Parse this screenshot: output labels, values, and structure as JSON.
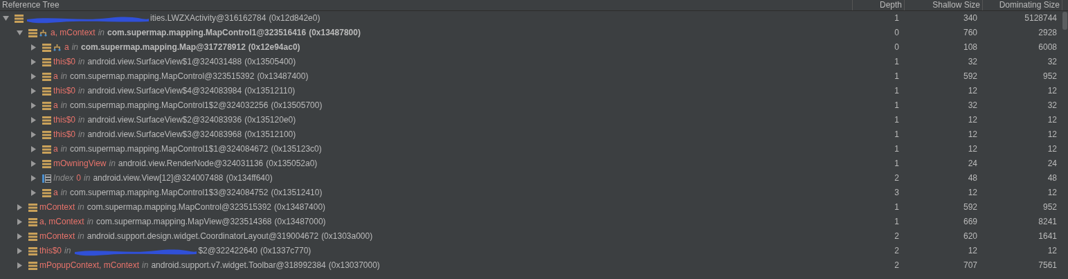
{
  "header": {
    "columns": [
      "Reference Tree",
      "Depth",
      "Shallow Size",
      "Dominating Size"
    ]
  },
  "tree": [
    {
      "kind": "instance",
      "redacted": true,
      "class": "ities.LWZXActivity@316162784",
      "address": "(0x12d842e0)",
      "bold": false,
      "path_icon": false,
      "expanded": true,
      "depth": "1",
      "shallow": "340",
      "dominating": "5128744",
      "children": [
        {
          "kind": "instance",
          "field": "a, mContext",
          "in": "in",
          "class": "com.supermap.mapping.MapControl1@323516416",
          "address": "(0x13487800)",
          "bold": true,
          "path_icon": true,
          "expanded": true,
          "depth": "0",
          "shallow": "760",
          "dominating": "2928",
          "children": [
            {
              "kind": "instance",
              "field": "a",
              "in": "in",
              "class": "com.supermap.mapping.Map@317278912",
              "address": "(0x12e94ac0)",
              "bold": true,
              "path_icon": true,
              "expanded": false,
              "depth": "0",
              "shallow": "108",
              "dominating": "6008"
            },
            {
              "kind": "instance",
              "field": "this$0",
              "in": "in",
              "class": "android.view.SurfaceView$1@324031488",
              "address": "(0x13505400)",
              "bold": false,
              "path_icon": false,
              "expanded": false,
              "depth": "1",
              "shallow": "32",
              "dominating": "32"
            },
            {
              "kind": "instance",
              "field": "a",
              "in": "in",
              "class": "com.supermap.mapping.MapControl@323515392",
              "address": "(0x13487400)",
              "bold": false,
              "path_icon": false,
              "expanded": false,
              "depth": "1",
              "shallow": "592",
              "dominating": "952"
            },
            {
              "kind": "instance",
              "field": "this$0",
              "in": "in",
              "class": "android.view.SurfaceView$4@324083984",
              "address": "(0x13512110)",
              "bold": false,
              "path_icon": false,
              "expanded": false,
              "depth": "1",
              "shallow": "12",
              "dominating": "12"
            },
            {
              "kind": "instance",
              "field": "a",
              "in": "in",
              "class": "com.supermap.mapping.MapControl1$2@324032256",
              "address": "(0x13505700)",
              "bold": false,
              "path_icon": false,
              "expanded": false,
              "depth": "1",
              "shallow": "32",
              "dominating": "32"
            },
            {
              "kind": "instance",
              "field": "this$0",
              "in": "in",
              "class": "android.view.SurfaceView$2@324083936",
              "address": "(0x135120e0)",
              "bold": false,
              "path_icon": false,
              "expanded": false,
              "depth": "1",
              "shallow": "12",
              "dominating": "12"
            },
            {
              "kind": "instance",
              "field": "this$0",
              "in": "in",
              "class": "android.view.SurfaceView$3@324083968",
              "address": "(0x13512100)",
              "bold": false,
              "path_icon": false,
              "expanded": false,
              "depth": "1",
              "shallow": "12",
              "dominating": "12"
            },
            {
              "kind": "instance",
              "field": "a",
              "in": "in",
              "class": "com.supermap.mapping.MapControl1$1@324084672",
              "address": "(0x135123c0)",
              "bold": false,
              "path_icon": false,
              "expanded": false,
              "depth": "1",
              "shallow": "12",
              "dominating": "12"
            },
            {
              "kind": "instance",
              "field": "mOwningView",
              "in": "in",
              "class": "android.view.RenderNode@324031136",
              "address": "(0x135052a0)",
              "bold": false,
              "path_icon": false,
              "expanded": false,
              "depth": "1",
              "shallow": "24",
              "dominating": "24"
            },
            {
              "kind": "array",
              "index_label": "Index",
              "field": "0",
              "in": "in",
              "class": "android.view.View[12]@324007488",
              "address": "(0x134ff640)",
              "bold": false,
              "path_icon": false,
              "expanded": false,
              "depth": "2",
              "shallow": "48",
              "dominating": "48"
            },
            {
              "kind": "instance",
              "field": "a",
              "in": "in",
              "class": "com.supermap.mapping.MapControl1$3@324084752",
              "address": "(0x13512410)",
              "bold": false,
              "path_icon": false,
              "expanded": false,
              "depth": "3",
              "shallow": "12",
              "dominating": "12"
            }
          ]
        },
        {
          "kind": "instance",
          "field": "mContext",
          "in": "in",
          "class": "com.supermap.mapping.MapControl@323515392",
          "address": "(0x13487400)",
          "bold": false,
          "path_icon": false,
          "expanded": false,
          "depth": "1",
          "shallow": "592",
          "dominating": "952"
        },
        {
          "kind": "instance",
          "field": "a, mContext",
          "in": "in",
          "class": "com.supermap.mapping.MapView@323514368",
          "address": "(0x13487000)",
          "bold": false,
          "path_icon": false,
          "expanded": false,
          "depth": "1",
          "shallow": "669",
          "dominating": "8241"
        },
        {
          "kind": "instance",
          "field": "mContext",
          "in": "in",
          "class": "android.support.design.widget.CoordinatorLayout@319004672",
          "address": "(0x1303a000)",
          "bold": false,
          "path_icon": false,
          "expanded": false,
          "depth": "2",
          "shallow": "620",
          "dominating": "1641"
        },
        {
          "kind": "instance",
          "field": "this$0",
          "in": "in",
          "redacted": true,
          "class": "$2@322422640",
          "address": "(0x1337c770)",
          "bold": false,
          "path_icon": false,
          "expanded": false,
          "depth": "2",
          "shallow": "12",
          "dominating": "12"
        },
        {
          "kind": "instance",
          "field": "mPopupContext, mContext",
          "in": "in",
          "class": "android.support.v7.widget.Toolbar@318992384",
          "address": "(0x13037000)",
          "bold": false,
          "path_icon": false,
          "expanded": false,
          "depth": "2",
          "shallow": "707",
          "dominating": "7561"
        }
      ]
    }
  ]
}
